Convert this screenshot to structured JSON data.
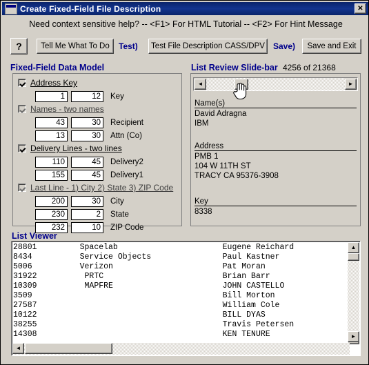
{
  "window": {
    "title": "Create Fixed-Field File Description",
    "close_label": "✕",
    "icon": "window-icon"
  },
  "help_line": "Need context sensitive help?  --  <F1> For HTML Tutorial  --  <F2> For Hint Message",
  "toolbar": {
    "help_button": "?",
    "tell_me_button": "Tell Me What To Do",
    "test_prefix_label": "Test)",
    "test_button": "Test File Description CASS/DPV",
    "save_prefix_label": "Save)",
    "save_exit_button": "Save and Exit"
  },
  "data_model": {
    "title": "Fixed-Field Data Model",
    "groups": [
      {
        "checked": true,
        "enabled": true,
        "label": "Address Key",
        "fields": [
          {
            "start": "1",
            "length": "12",
            "name": "Key",
            "focused": false
          }
        ]
      },
      {
        "checked": true,
        "enabled": false,
        "label": "Names  -  two names",
        "fields": [
          {
            "start": "43",
            "length": "30",
            "name": "Recipient",
            "focused": false
          },
          {
            "start": "13",
            "length": "30",
            "name": "Attn (Co)",
            "focused": false
          }
        ]
      },
      {
        "checked": true,
        "enabled": true,
        "label": "Delivery Lines  -  two lines",
        "fields": [
          {
            "start": "110",
            "length": "45",
            "name": "Delivery2",
            "focused": false
          },
          {
            "start": "155",
            "length": "45",
            "name": "Delivery1",
            "focused": false
          }
        ]
      },
      {
        "checked": true,
        "enabled": false,
        "label": "Last Line  -  1) City  2) State  3) ZIP Code",
        "fields": [
          {
            "start": "200",
            "length": "30",
            "name": "City",
            "focused": false
          },
          {
            "start": "230",
            "length": "2",
            "name": "State",
            "focused": false
          },
          {
            "start": "232",
            "length": "10",
            "name": "ZIP Code",
            "focused": true
          }
        ]
      }
    ]
  },
  "slide_bar": {
    "title": "List Review Slide-bar",
    "counter": "4256 of 21368",
    "scroll_left_arrow": "◄",
    "scroll_right_arrow": "►",
    "cursor": "hand-cursor"
  },
  "record": {
    "names_label": "Name(s)",
    "names_lines": [
      "David Adragna",
      "IBM"
    ],
    "address_label": "Address",
    "address_lines": [
      "PMB 1",
      "104 W 11TH ST",
      "TRACY CA 95376-3908"
    ],
    "key_label": "Key",
    "key_lines": [
      "8338"
    ]
  },
  "list_viewer": {
    "title": "List Viewer",
    "rows": [
      {
        "id": "28801",
        "company": "Spacelab",
        "name": "Eugene Reichard"
      },
      {
        "id": "8434",
        "company": "Service Objects",
        "name": "Paul Kastner"
      },
      {
        "id": "5006",
        "company": "Verizon",
        "name": "Pat Moran"
      },
      {
        "id": "31922",
        "company": " PRTC",
        "name": "Brian Barr"
      },
      {
        "id": "10309",
        "company": " MAPFRE",
        "name": "JOHN CASTELLO"
      },
      {
        "id": "3509",
        "company": "",
        "name": "Bill Morton"
      },
      {
        "id": "27587",
        "company": "",
        "name": "William Cole"
      },
      {
        "id": "10122",
        "company": "",
        "name": "BILL DYAS"
      },
      {
        "id": "38255",
        "company": "",
        "name": "Travis Petersen"
      },
      {
        "id": "14308",
        "company": "",
        "name": "KEN TENURE"
      }
    ],
    "scroll_up_arrow": "▲",
    "scroll_down_arrow": "▼",
    "scroll_left_arrow": "◄",
    "scroll_right_arrow": "►"
  },
  "colors": {
    "window_face": "#d4d0c8",
    "titlebar": "#0a246a",
    "heading_blue": "#00008b",
    "field_white": "#ffffff"
  }
}
